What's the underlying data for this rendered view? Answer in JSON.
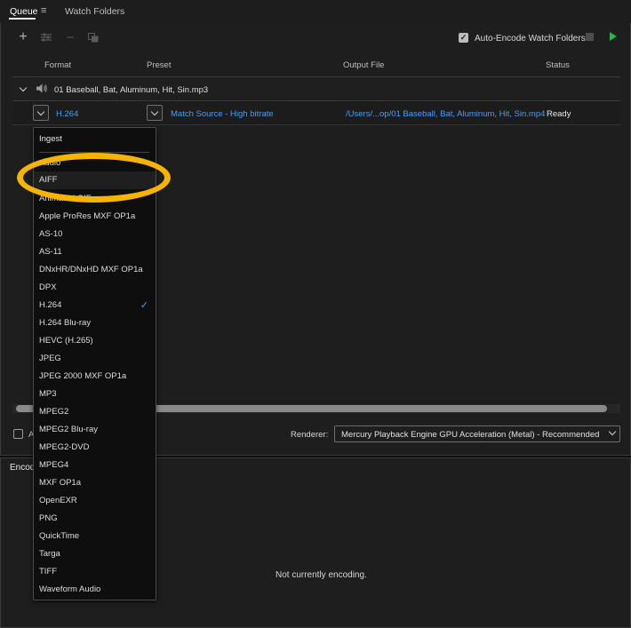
{
  "tabs": {
    "queue": "Queue",
    "menu_glyph": "≡",
    "watch_folders": "Watch Folders"
  },
  "toolbar": {
    "add_icon": "+",
    "settings_icon": "settings-sliders",
    "remove_icon": "−",
    "duplicate_icon": "duplicate",
    "auto_encode_label": "Auto-Encode Watch Folders",
    "auto_encode_checked": true
  },
  "columns": {
    "format": "Format",
    "preset": "Preset",
    "output_file": "Output File",
    "status": "Status"
  },
  "source": {
    "name": "01 Baseball, Bat, Aluminum, Hit, Sin.mp3"
  },
  "output": {
    "format": "H.264",
    "preset": "Match Source - High bitrate",
    "file": "/Users/...op/01 Baseball, Bat, Aluminum, Hit, Sin.mp4",
    "status": "Ready"
  },
  "bottom": {
    "checkbox_label_partial": "A",
    "renderer_label": "Renderer:",
    "renderer_value": "Mercury Playback Engine GPU Acceleration (Metal) - Recommended"
  },
  "encoding": {
    "title_partial": "Encod",
    "status": "Not currently encoding."
  },
  "format_menu": {
    "header": "Ingest",
    "items": [
      "Audio",
      "AIFF",
      "Animated GIF",
      "Apple ProRes MXF OP1a",
      "AS-10",
      "AS-11",
      "DNxHR/DNxHD MXF OP1a",
      "DPX",
      "H.264",
      "H.264 Blu-ray",
      "HEVC (H.265)",
      "JPEG",
      "JPEG 2000 MXF OP1a",
      "MP3",
      "MPEG2",
      "MPEG2 Blu-ray",
      "MPEG2-DVD",
      "MPEG4",
      "MXF OP1a",
      "OpenEXR",
      "PNG",
      "QuickTime",
      "Targa",
      "TIFF",
      "Waveform Audio"
    ],
    "selected": "H.264",
    "highlighted": "AIFF"
  },
  "colors": {
    "accent_blue": "#4a9ff5",
    "annotation": "#f5b400",
    "play_green": "#2fb24a"
  }
}
